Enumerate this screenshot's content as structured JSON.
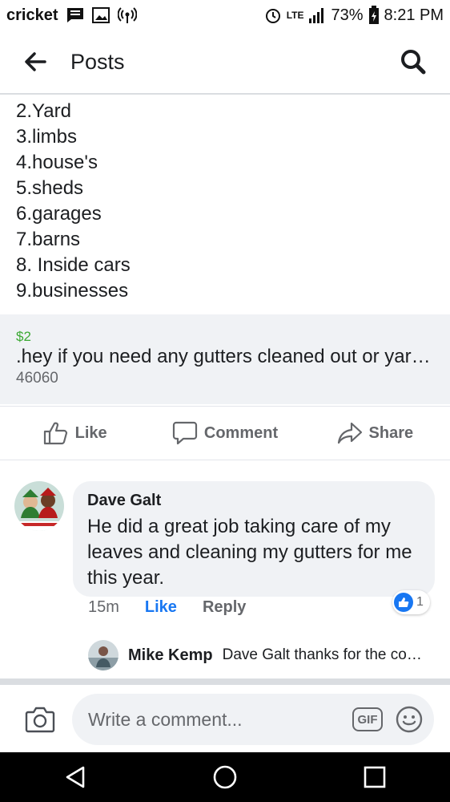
{
  "status_bar": {
    "carrier": "cricket",
    "network": "LTE",
    "battery": "73%",
    "time": "8:21 PM"
  },
  "header": {
    "title": "Posts"
  },
  "post": {
    "list_items": [
      "2.Yard",
      "3.limbs",
      "4.house's",
      "5.sheds",
      "6.garages",
      "7.barns",
      "8. Inside cars",
      "9.businesses"
    ],
    "preview": {
      "price": "$2",
      "title": ".hey if you need any gutters cleaned out or yard work done or anything call me at",
      "subtitle": "46060"
    },
    "actions": {
      "like": "Like",
      "comment": "Comment",
      "share": "Share"
    }
  },
  "comment": {
    "author": "Dave Galt",
    "text": "He did a great job taking care of my leaves and cleaning my gutters for me this year.",
    "time": "15m",
    "like_label": "Like",
    "reply_label": "Reply",
    "reaction_count": "1"
  },
  "reply_preview": {
    "author": "Mike Kemp",
    "text": "Dave Galt thanks for the compliment"
  },
  "composer": {
    "placeholder": "Write a comment...",
    "gif_label": "GIF"
  },
  "colors": {
    "accent": "#1877f2",
    "price": "#3aa832",
    "muted": "#65676b",
    "bubble": "#f0f2f5"
  },
  "icons": [
    "message-icon",
    "image-icon",
    "hotspot-icon",
    "alarm-icon",
    "signal-icon",
    "battery-icon",
    "back-arrow-icon",
    "search-icon",
    "like-icon",
    "comment-icon",
    "share-icon",
    "camera-icon",
    "gif-icon",
    "emoji-icon",
    "nav-back-icon",
    "nav-home-icon",
    "nav-recents-icon"
  ]
}
